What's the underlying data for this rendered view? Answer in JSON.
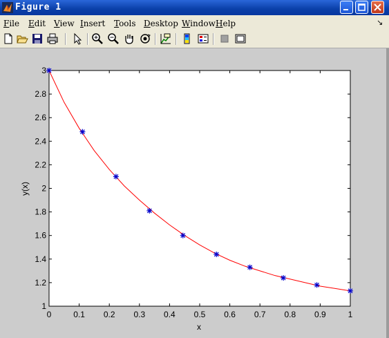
{
  "window": {
    "title": "Figure 1"
  },
  "menu": [
    {
      "label": "File",
      "key": "F",
      "rest": "ile"
    },
    {
      "label": "Edit",
      "key": "E",
      "rest": "dit"
    },
    {
      "label": "View",
      "key": "V",
      "rest": "iew"
    },
    {
      "label": "Insert",
      "key": "I",
      "rest": "nsert"
    },
    {
      "label": "Tools",
      "key": "T",
      "rest": "ools"
    },
    {
      "label": "Desktop",
      "key": "D",
      "rest": "esktop"
    },
    {
      "label": "Window",
      "key": "W",
      "rest": "indow"
    },
    {
      "label": "Help",
      "key": "H",
      "rest": "elp"
    }
  ],
  "toolbar": {
    "icons": [
      "new-file-icon",
      "open-folder-icon",
      "save-icon",
      "print-icon",
      "select-arrow-icon",
      "zoom-in-icon",
      "zoom-out-icon",
      "pan-hand-icon",
      "rotate-3d-icon",
      "data-cursor-icon",
      "colorbar-icon",
      "legend-icon",
      "hide-plot-tools-icon",
      "show-plot-tools-icon"
    ]
  },
  "chart_data": {
    "type": "line",
    "xlabel": "x",
    "ylabel": "y(x)",
    "xlim": [
      0,
      1
    ],
    "ylim": [
      1,
      3
    ],
    "xticks": [
      "0",
      "0.1",
      "0.2",
      "0.3",
      "0.4",
      "0.5",
      "0.6",
      "0.7",
      "0.8",
      "0.9",
      "1"
    ],
    "yticks": [
      "1",
      "1.2",
      "1.4",
      "1.6",
      "1.8",
      "2",
      "2.2",
      "2.4",
      "2.6",
      "2.8",
      "3"
    ],
    "grid": false,
    "series": [
      {
        "style": "line",
        "color": "#ff0000",
        "x": [
          0,
          0.05,
          0.1,
          0.15,
          0.2,
          0.25,
          0.3,
          0.35,
          0.4,
          0.45,
          0.5,
          0.55,
          0.6,
          0.65,
          0.7,
          0.75,
          0.8,
          0.85,
          0.9,
          0.95,
          1
        ],
        "y": [
          3.0,
          2.73,
          2.51,
          2.32,
          2.16,
          2.02,
          1.9,
          1.79,
          1.69,
          1.6,
          1.52,
          1.45,
          1.39,
          1.34,
          1.3,
          1.26,
          1.23,
          1.2,
          1.17,
          1.15,
          1.13
        ]
      },
      {
        "style": "markers",
        "marker": "*",
        "color": "#0000cc",
        "x": [
          0,
          0.1111,
          0.2222,
          0.3333,
          0.4444,
          0.5556,
          0.6667,
          0.7778,
          0.8889,
          1
        ],
        "y": [
          3.0,
          2.48,
          2.1,
          1.81,
          1.6,
          1.44,
          1.33,
          1.24,
          1.18,
          1.13
        ]
      }
    ]
  }
}
